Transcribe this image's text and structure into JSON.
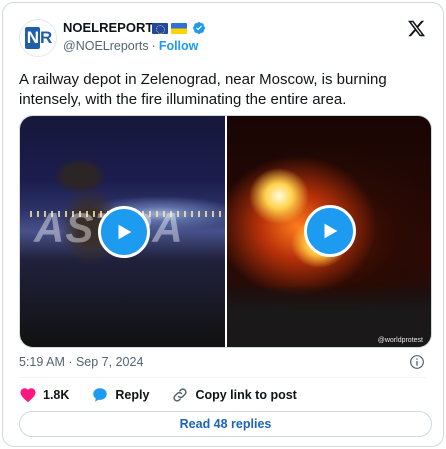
{
  "author": {
    "avatar_text_a": "N",
    "avatar_text_b": "R",
    "name": "NOELREPORTS",
    "handle": "@NOELreports",
    "separator": "·",
    "follow_label": "Follow"
  },
  "tweet": {
    "text": "A railway depot in Zelenograd, near Moscow, is burning intensely, with the fire illuminating the entire area."
  },
  "media": {
    "left_watermark": "ASTRA",
    "right_credit": "@worldprotest"
  },
  "meta": {
    "timestamp": "5:19 AM · Sep 7, 2024"
  },
  "actions": {
    "likes": "1.8K",
    "reply_label": "Reply",
    "copy_label": "Copy link to post"
  },
  "read_replies_label": "Read 48 replies",
  "colors": {
    "accent": "#1d9bf0",
    "like": "#f91880",
    "text": "#0f1419",
    "muted": "#536471"
  }
}
